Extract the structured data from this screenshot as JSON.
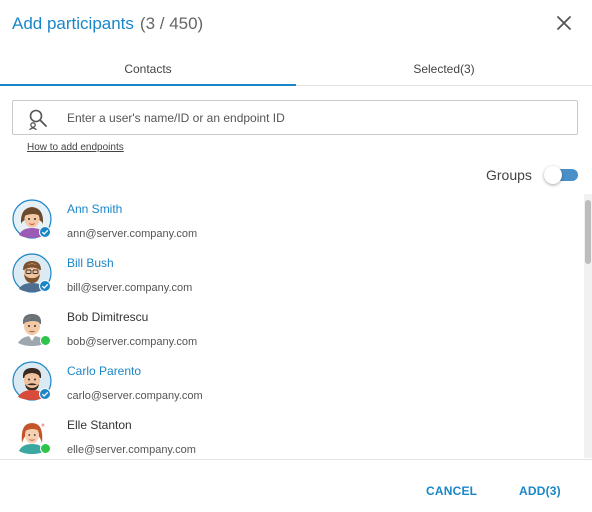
{
  "header": {
    "title": "Add participants",
    "count": "(3 / 450)",
    "close_icon": "close-icon"
  },
  "tabs": [
    {
      "label": "Contacts",
      "active": true
    },
    {
      "label": "Selected(3)",
      "active": false
    }
  ],
  "search": {
    "placeholder": "Enter a user's name/ID or an endpoint ID",
    "value": "",
    "icon": "search-user-icon"
  },
  "help_link": "How to add endpoints",
  "groups": {
    "label": "Groups",
    "enabled": false
  },
  "contacts": [
    {
      "name": "Ann Smith",
      "email": "ann@server.company.com",
      "selected": true,
      "status": "selected",
      "avatar": "woman-avatar"
    },
    {
      "name": "Bill Bush",
      "email": "bill@server.company.com",
      "selected": true,
      "status": "selected",
      "avatar": "bearded-man-avatar"
    },
    {
      "name": "Bob Dimitrescu",
      "email": "bob@server.company.com",
      "selected": false,
      "status": "online",
      "avatar": "man-avatar"
    },
    {
      "name": "Carlo Parento",
      "email": "carlo@server.company.com",
      "selected": true,
      "status": "selected",
      "avatar": "mustache-man-avatar"
    },
    {
      "name": "Elle Stanton",
      "email": "elle@server.company.com",
      "selected": false,
      "status": "online",
      "avatar": "woman-red-hair-avatar"
    }
  ],
  "footer": {
    "cancel_label": "CANCEL",
    "add_label": "ADD(3)"
  },
  "colors": {
    "accent": "#1a86c8",
    "online": "#2ec44a",
    "selected_badge": "#1a86c8"
  }
}
